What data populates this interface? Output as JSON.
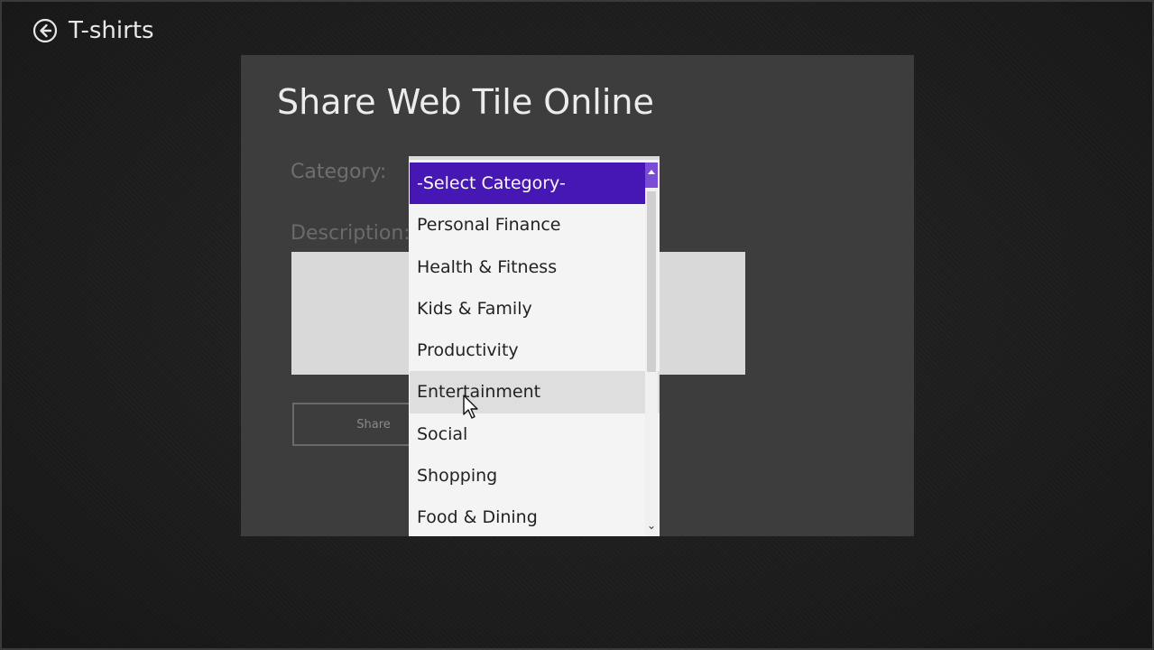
{
  "header": {
    "title": "T-shirts",
    "back_icon": "back-arrow-circle-icon"
  },
  "dialog": {
    "title": "Share Web Tile Online",
    "category_label": "Category:",
    "description_label": "Description:",
    "description_value": "",
    "error_text": "",
    "share_label": "Share"
  },
  "dropdown": {
    "selected_index": 0,
    "hover_index": 5,
    "options": [
      "-Select Category-",
      "Personal Finance",
      "Health & Fitness",
      "Kids & Family",
      "Productivity",
      "Entertainment",
      "Social",
      "Shopping",
      "Food & Dining"
    ],
    "scroll_down_glyph": "⌄"
  },
  "colors": {
    "accent": "#4617b4",
    "panel": "#3d3d3d",
    "error": "#b01010"
  }
}
